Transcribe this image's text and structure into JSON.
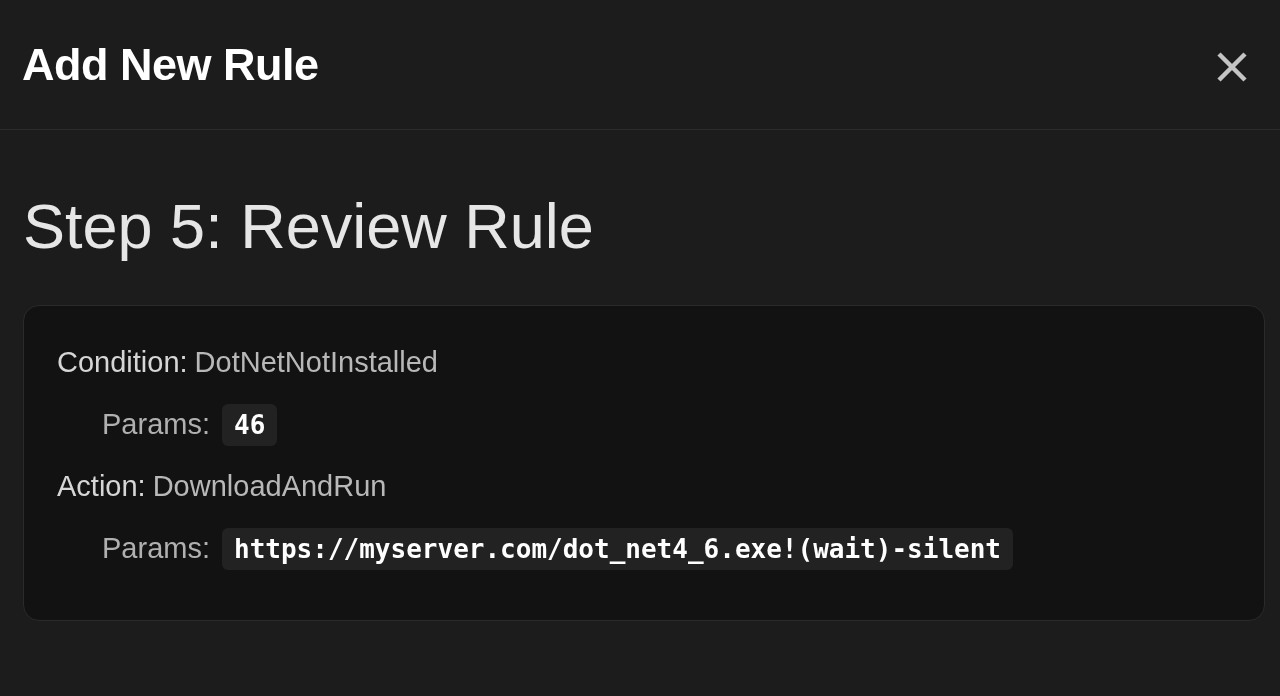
{
  "dialog": {
    "title": "Add New Rule",
    "step_title": "Step 5: Review Rule",
    "review": [
      {
        "kind": "field",
        "label": "Condition:",
        "value": "DotNetNotInstalled"
      },
      {
        "kind": "param",
        "label": "Params:",
        "value": "46"
      },
      {
        "kind": "field",
        "label": "Action:",
        "value": "DownloadAndRun"
      },
      {
        "kind": "param",
        "label": "Params:",
        "value": "https://myserver.com/dot_net4_6.exe!(wait)-silent"
      }
    ]
  }
}
